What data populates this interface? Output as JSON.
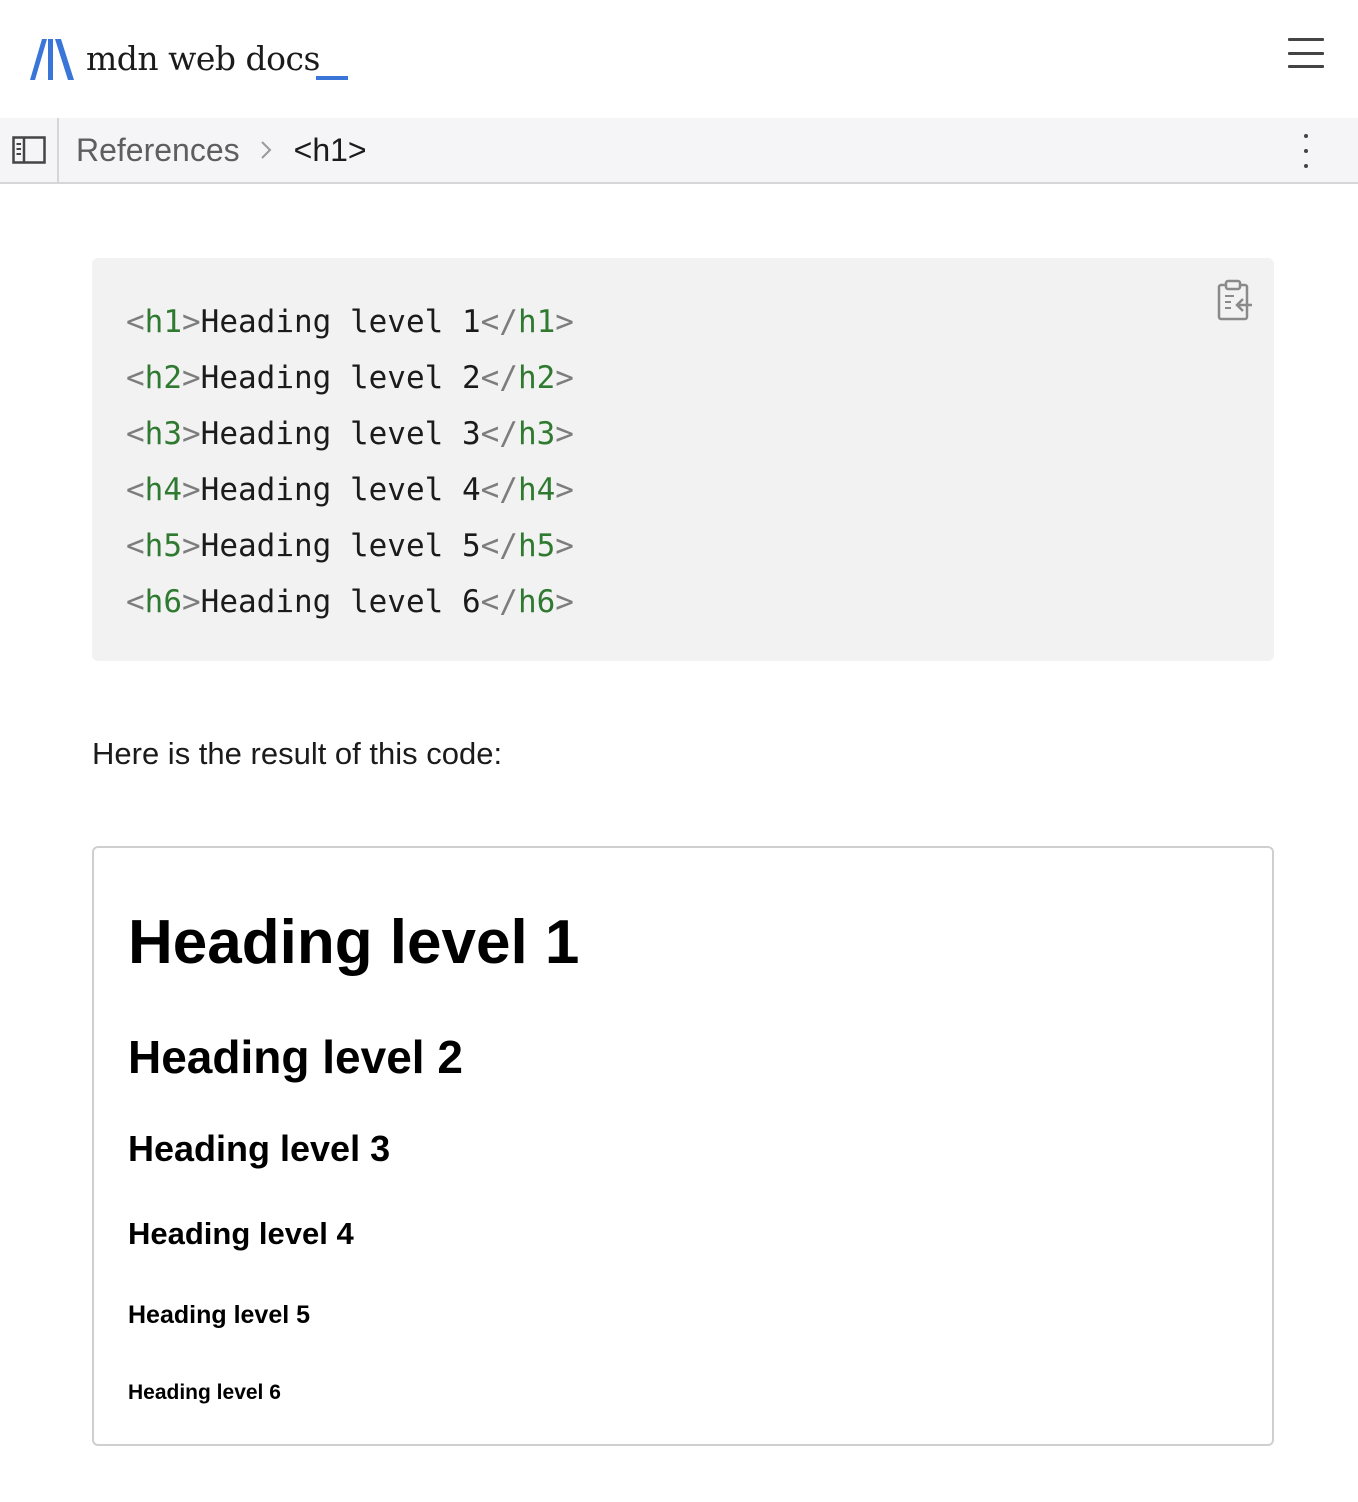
{
  "header": {
    "logo_text": "mdn web docs",
    "logo_icon": "mdn-m-logo-icon",
    "menu_icon": "hamburger-menu-icon",
    "accent_color": "#3a76d8"
  },
  "breadcrumb": {
    "sidebar_icon": "sidebar-panel-icon",
    "items": [
      {
        "label": "References"
      },
      {
        "label": "<h1>"
      }
    ],
    "separator_icon": "chevron-right-icon",
    "more_icon": "vertical-dots-icon"
  },
  "code_block": {
    "copy_icon": "clipboard-copy-icon",
    "lines": [
      {
        "open": "h1",
        "text": "Heading level 1",
        "close": "h1"
      },
      {
        "open": "h2",
        "text": "Heading level 2",
        "close": "h2"
      },
      {
        "open": "h3",
        "text": "Heading level 3",
        "close": "h3"
      },
      {
        "open": "h4",
        "text": "Heading level 4",
        "close": "h4"
      },
      {
        "open": "h5",
        "text": "Heading level 5",
        "close": "h5"
      },
      {
        "open": "h6",
        "text": "Heading level 6",
        "close": "h6"
      }
    ],
    "colors": {
      "tag": "#2f7a30",
      "punctuation": "#7d7d7d",
      "background": "#f2f2f2"
    }
  },
  "content": {
    "result_intro": "Here is the result of this code:"
  },
  "result": {
    "headings": [
      "Heading level 1",
      "Heading level 2",
      "Heading level 3",
      "Heading level 4",
      "Heading level 5",
      "Heading level 6"
    ]
  }
}
